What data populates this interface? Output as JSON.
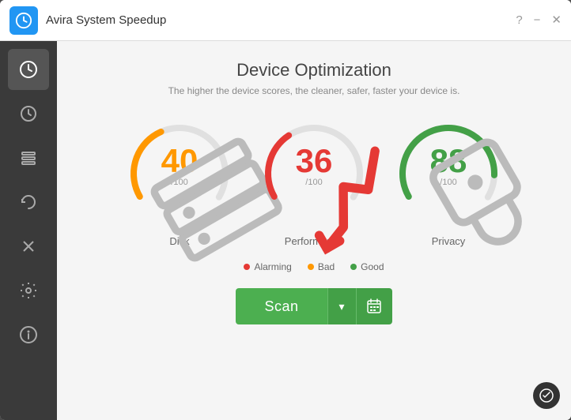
{
  "titlebar": {
    "title": "Avira System Speedup",
    "help_label": "?",
    "minimize_label": "−",
    "close_label": "✕"
  },
  "sidebar": {
    "items": [
      {
        "id": "dashboard",
        "icon": "speedometer",
        "active": true
      },
      {
        "id": "clock",
        "icon": "clock",
        "active": false
      },
      {
        "id": "list",
        "icon": "list",
        "active": false
      },
      {
        "id": "refresh",
        "icon": "refresh",
        "active": false
      },
      {
        "id": "tools",
        "icon": "tools",
        "active": false
      },
      {
        "id": "settings",
        "icon": "settings",
        "active": false
      },
      {
        "id": "info",
        "icon": "info",
        "active": false
      }
    ]
  },
  "content": {
    "title": "Device Optimization",
    "subtitle": "The higher the device scores, the cleaner, safer, faster your device is.",
    "gauges": [
      {
        "id": "disk",
        "value": 40,
        "max": 100,
        "denom": "/100",
        "label": "Disk",
        "color": "#ff9800",
        "track_color": "#e0e0e0",
        "arc_pct": 0.4,
        "icon": "db"
      },
      {
        "id": "performance",
        "value": 36,
        "max": 100,
        "denom": "/100",
        "label": "Performance",
        "color": "#e53935",
        "track_color": "#e0e0e0",
        "arc_pct": 0.36,
        "icon": "chart"
      },
      {
        "id": "privacy",
        "value": 88,
        "max": 100,
        "denom": "/100",
        "label": "Privacy",
        "color": "#43a047",
        "track_color": "#e0e0e0",
        "arc_pct": 0.88,
        "icon": "lock"
      }
    ],
    "legend": [
      {
        "label": "Alarming",
        "color": "#e53935"
      },
      {
        "label": "Bad",
        "color": "#ff9800"
      },
      {
        "label": "Good",
        "color": "#43a047"
      }
    ],
    "scan_button": {
      "label": "Scan",
      "dropdown_icon": "▾",
      "calendar_icon": "📅"
    }
  }
}
